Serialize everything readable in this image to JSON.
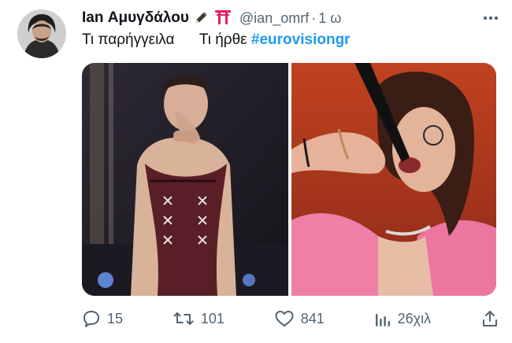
{
  "tweet": {
    "author_name": "Ian Αμυγδάλου",
    "badge_emojis": [
      "pencil-icon",
      "torii-gate-icon"
    ],
    "handle": "@ian_omrf",
    "separator": "·",
    "time": "1 ω",
    "text_part1": "Τι παρήγγειλα      Τι ήρθε ",
    "hashtag": "#eurovisiongr",
    "colors": {
      "hashtag": "#1d9bf0",
      "meta": "#536471",
      "text": "#0f1419"
    }
  },
  "actions": {
    "replies": "15",
    "retweets": "101",
    "likes": "841",
    "views": "26χιλ"
  }
}
